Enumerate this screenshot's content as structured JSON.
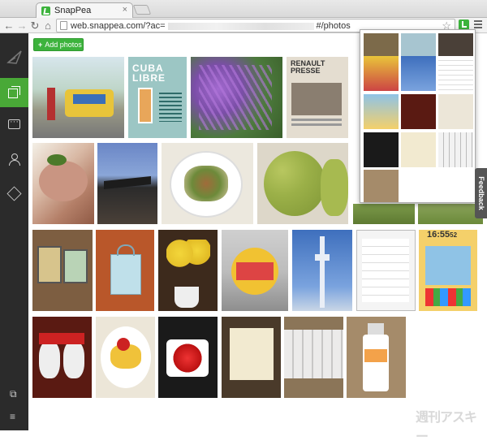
{
  "browser": {
    "tab_title": "SnapPea",
    "tab_close": "×",
    "url_prefix": "web.snappea.com/?ac=",
    "url_suffix": "#/photos",
    "back": "←",
    "forward": "→",
    "reload": "↻",
    "home": "⌂",
    "star": "☆"
  },
  "sidebar": {
    "items": [
      {
        "icon": "photos-icon",
        "active": true
      },
      {
        "icon": "messages-icon",
        "active": false
      },
      {
        "icon": "contacts-icon",
        "active": false
      },
      {
        "icon": "apps-icon",
        "active": false
      }
    ],
    "bottom_icons": [
      "copy-icon",
      "menu-icon"
    ]
  },
  "toolbar": {
    "add_photos_label": "Add photos",
    "add_icon": "+"
  },
  "photos": {
    "cuba_title": "CUBA LIBRE",
    "renault_title": "RENAULT PRESSE",
    "phone_clock": "16:55",
    "phone_seconds": "52"
  },
  "feedback": {
    "label": "Feedback"
  },
  "watermark": "週刊アスキー",
  "colors": {
    "accent": "#3db33d",
    "sidebar_bg": "#2b2b2b"
  }
}
